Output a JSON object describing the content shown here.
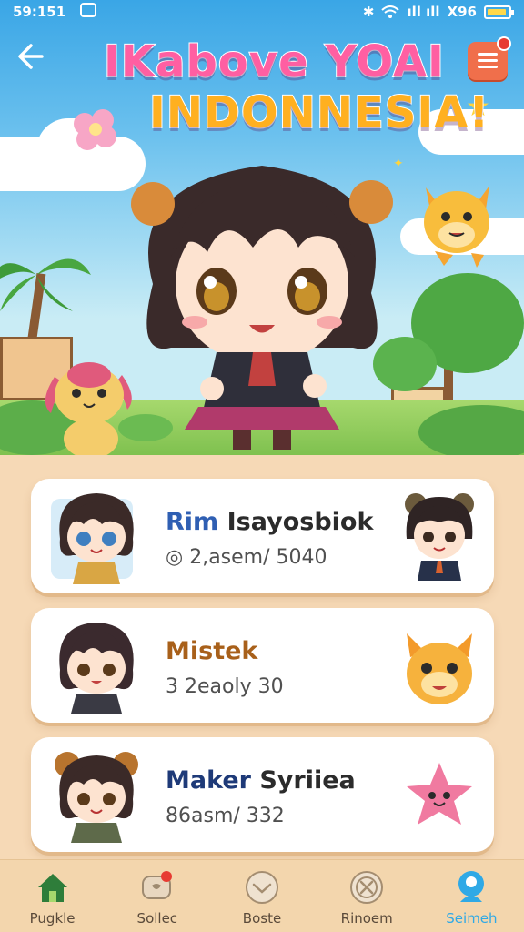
{
  "status_bar": {
    "time": "59:151",
    "signal": "ıll ıll",
    "network": "X96"
  },
  "header": {
    "title_line1": "IKabove YOAI",
    "title_line2": "INDONNESIA!"
  },
  "colors": {
    "sky_top": "#3aa6e6",
    "card_bg": "#ffffff",
    "page_bg": "#f6d9b6",
    "accent_red": "#f06f4b",
    "nav_active": "#2fa9e6"
  },
  "players": [
    {
      "name_part1": "Rim",
      "name_part2": "Isayosbiok",
      "stat": "2,asem/ 5040",
      "accent": "#2f5fb3",
      "rest": "#2b2b2b"
    },
    {
      "name_part1": "Mistek",
      "name_part2": "",
      "stat": "3 2eaoly 30",
      "accent": "#a8601a",
      "rest": "#2b2b2b"
    },
    {
      "name_part1": "Maker",
      "name_part2": "Syriiea",
      "stat": "86asm/ 332",
      "accent": "#1e3a78",
      "rest": "#2b2b2b"
    }
  ],
  "nav": {
    "items": [
      {
        "label": "Pugkle",
        "icon": "home-icon"
      },
      {
        "label": "Sollec",
        "icon": "chat-heart-icon"
      },
      {
        "label": "Boste",
        "icon": "heart-icon"
      },
      {
        "label": "Rinoem",
        "icon": "x-circle-icon"
      },
      {
        "label": "Seimeh",
        "icon": "profile-icon"
      }
    ]
  }
}
